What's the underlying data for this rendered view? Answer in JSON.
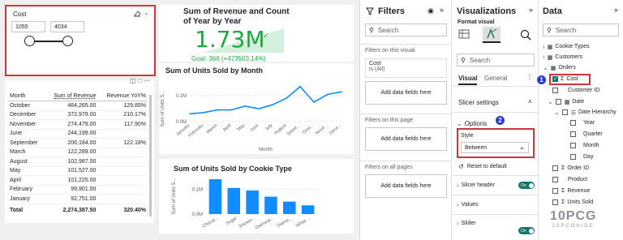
{
  "slicer": {
    "title": "Cost",
    "min_value": "1055",
    "max_value": "4034",
    "badge": "3"
  },
  "kpi": {
    "title_line1": "Sum of Revenue and Count",
    "title_line2": "of Year by Year",
    "value": "1.73M",
    "goal": "Goal: 366 (+473503.14%)"
  },
  "month_table": {
    "headers": [
      "Month",
      "Sum of Revenue",
      "Revenue YoY%"
    ],
    "rows": [
      {
        "month": "October",
        "revenue": "464,265.00",
        "yoy": "129.85%"
      },
      {
        "month": "December",
        "revenue": "372,979.00",
        "yoy": "210.17%"
      },
      {
        "month": "November",
        "revenue": "274,479.00",
        "yoy": "117.90%"
      },
      {
        "month": "June",
        "revenue": "244,199.00",
        "yoy": ""
      },
      {
        "month": "September",
        "revenue": "206,184.00",
        "yoy": "122.18%"
      },
      {
        "month": "March",
        "revenue": "122,289.00",
        "yoy": ""
      },
      {
        "month": "August",
        "revenue": "102,987.00",
        "yoy": ""
      },
      {
        "month": "May",
        "revenue": "101,527.00",
        "yoy": ""
      },
      {
        "month": "April",
        "revenue": "101,225.00",
        "yoy": ""
      },
      {
        "month": "February",
        "revenue": "99,901.00",
        "yoy": ""
      },
      {
        "month": "January",
        "revenue": "92,751.00",
        "yoy": ""
      }
    ],
    "total_label": "Total",
    "total_revenue": "2,274,387.50",
    "total_yoy": "320.40%"
  },
  "chart_data": [
    {
      "type": "line",
      "title": "Sum of Units Sold by Month",
      "xlabel": "Month",
      "ylabel": "Sum of Units S...",
      "categories": [
        "January",
        "February",
        "March",
        "April",
        "May",
        "June",
        "July",
        "August",
        "Septe...",
        "Octo...",
        "Nove...",
        "Dece..."
      ],
      "values": [
        0.03,
        0.035,
        0.045,
        0.045,
        0.06,
        0.05,
        0.065,
        0.09,
        0.135,
        0.075,
        0.105,
        0.115
      ],
      "y_ticks": [
        "0.1M",
        "0.0M"
      ],
      "ylim": [
        0,
        0.15
      ]
    },
    {
      "type": "bar",
      "title": "Sum of Units Sold by Cookie Type",
      "ylabel": "Sum of Units S...",
      "categories": [
        "Chocol...",
        "Sugar",
        "Snicker...",
        "Oatmeal...",
        "Oatme...",
        "White ..."
      ],
      "values": [
        0.14,
        0.105,
        0.095,
        0.07,
        0.05,
        0.035
      ],
      "y_ticks": [
        "0.1M",
        "0.0M"
      ],
      "ylim": [
        0,
        0.15
      ],
      "bar_color": "#118dff"
    }
  ],
  "filters": {
    "title": "Filters",
    "search_placeholder": "Search",
    "on_visual_label": "Filters on this visual",
    "cost_filter_name": "Cost",
    "cost_filter_value": "is (All)",
    "add_fields_label": "Add data fields here",
    "on_page_label": "Filters on this page",
    "all_pages_label": "Filters on all pages"
  },
  "visualizations": {
    "title": "Visualizations",
    "format_visual_label": "Format visual",
    "search_placeholder": "Search",
    "tab_visual": "Visual",
    "tab_general": "General",
    "slicer_settings": "Slicer settings",
    "options_label": "Options",
    "options_badge": "2",
    "style_label": "Style",
    "style_value": "Between",
    "reset_label": "Reset to default",
    "slicer_header": "Slicer header",
    "values_label": "Values",
    "slider_label": "Slider",
    "toggle_on": "On"
  },
  "data_pane": {
    "title": "Data",
    "search_placeholder": "Search",
    "badge": "1",
    "tables": [
      {
        "name": "Cookie Types"
      },
      {
        "name": "Customers"
      },
      {
        "name": "Orders"
      }
    ],
    "fields": [
      "Cost",
      "Customer ID",
      "Date",
      "Date Hierarchy",
      "Year",
      "Quarter",
      "Month",
      "Day",
      "Order ID",
      "Product",
      "Revenue",
      "Units Sold"
    ],
    "watermark_text": "10PCG",
    "watermark_sub": "10PCGUIDE"
  },
  "colors": {
    "accent_red": "#d13438",
    "badge_blue": "#2b3ccf",
    "kpi_green": "#1aab40",
    "line_blue": "#118dff",
    "toggle_green": "#117865"
  }
}
